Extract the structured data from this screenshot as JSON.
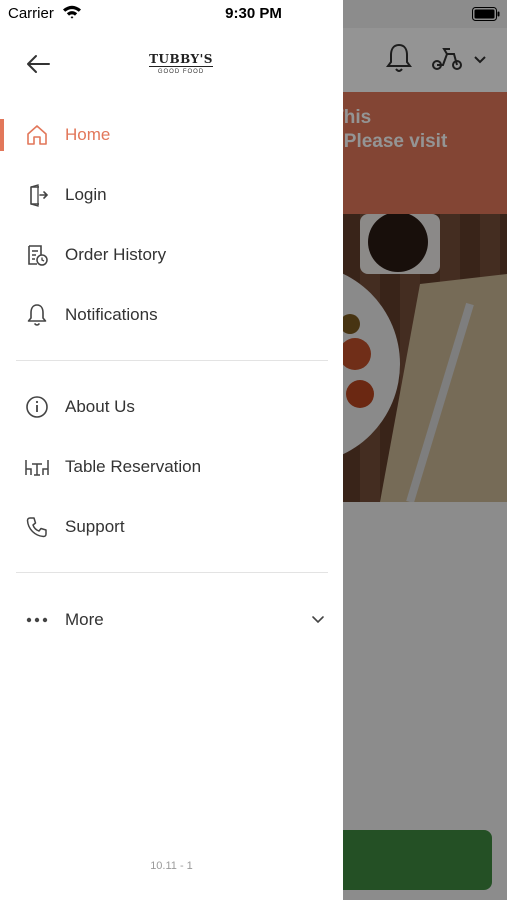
{
  "status_bar": {
    "carrier": "Carrier",
    "time": "9:30 PM"
  },
  "header": {
    "logo_text": "TUBBY'S",
    "logo_subtext": "GOOD FOOD"
  },
  "menu": {
    "items": [
      {
        "label": "Home",
        "icon": "home-icon",
        "active": true
      },
      {
        "label": "Login",
        "icon": "login-icon",
        "active": false
      },
      {
        "label": "Order History",
        "icon": "order-history-icon",
        "active": false
      },
      {
        "label": "Notifications",
        "icon": "bell-icon",
        "active": false
      },
      {
        "label": "About Us",
        "icon": "info-icon",
        "active": false
      },
      {
        "label": "Table Reservation",
        "icon": "table-icon",
        "active": false
      },
      {
        "label": "Support",
        "icon": "phone-icon",
        "active": false
      },
      {
        "label": "More",
        "icon": "ellipsis-icon",
        "active": false
      }
    ]
  },
  "version": "10.11 - 1",
  "background": {
    "banner_text": "d, This\non. Please visit\n/"
  },
  "colors": {
    "accent": "#e2775a",
    "banner": "#e2775a",
    "cta": "#3f8a40"
  }
}
